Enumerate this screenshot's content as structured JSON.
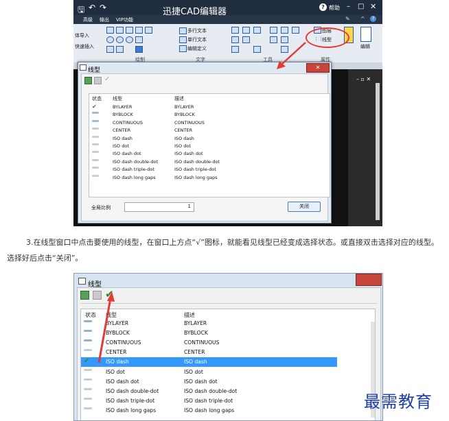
{
  "screenshot1": {
    "window_title": "迅捷CAD编辑器",
    "help_label": "帮助",
    "menu": [
      "高级",
      "输出",
      "VIP功能"
    ],
    "ribbon": {
      "left_labels": [
        "体导入",
        "快速插入"
      ],
      "text_labels": [
        "多行文本",
        "单行文本",
        "编辑定义"
      ],
      "groups": [
        "绘制",
        "文字",
        "工具",
        "属性"
      ],
      "linetype_button": "线型",
      "layer_button": "图层",
      "edit_label": "编辑"
    },
    "dialog": {
      "title": "线型",
      "columns": [
        "状态",
        "线型",
        "描述"
      ],
      "rows": [
        {
          "status": "current",
          "name": "BYLAYER",
          "desc": "BYLAYER"
        },
        {
          "status": "normal",
          "name": "BYBLOCK",
          "desc": "BYBLOCK"
        },
        {
          "status": "normal",
          "name": "CONTINUOUS",
          "desc": "CONTINUOUS"
        },
        {
          "status": "light",
          "name": "CENTER",
          "desc": "CENTER"
        },
        {
          "status": "light",
          "name": "ISO dash",
          "desc": "ISO dash"
        },
        {
          "status": "light",
          "name": "ISO dot",
          "desc": "ISO dot"
        },
        {
          "status": "light",
          "name": "ISO dash dot",
          "desc": "ISO dash dot"
        },
        {
          "status": "light",
          "name": "ISO dash double-dot",
          "desc": "ISO dash double-dot"
        },
        {
          "status": "light",
          "name": "ISO dash triple-dot",
          "desc": "ISO dash triple-dot"
        },
        {
          "status": "light",
          "name": "ISO dash long gaps",
          "desc": "ISO dash long gaps"
        }
      ],
      "scale_label": "全局比例",
      "scale_value": "1",
      "close_button": "关闭"
    }
  },
  "instruction": "3.在线型窗口中点击要使用的线型，在窗口上方点“√”图标，就能看见线型已经变成选择状态。或直接双击选择对应的线型。选择好后点击“关闭”。",
  "screenshot2": {
    "dialog_title": "线型",
    "columns": [
      "状态",
      "线型",
      "描述"
    ],
    "rows": [
      {
        "status": "normal",
        "name": "BYLAYER",
        "desc": "BYLAYER"
      },
      {
        "status": "normal",
        "name": "BYBLOCK",
        "desc": "BYBLOCK"
      },
      {
        "status": "normal",
        "name": "CONTINUOUS",
        "desc": "CONTINUOUS"
      },
      {
        "status": "light",
        "name": "CENTER",
        "desc": "CENTER"
      },
      {
        "status": "selected",
        "name": "ISO dash",
        "desc": "ISO dash"
      },
      {
        "status": "light",
        "name": "ISO dot",
        "desc": "ISO dot"
      },
      {
        "status": "light",
        "name": "ISO dash dot",
        "desc": "ISO dash dot"
      },
      {
        "status": "light",
        "name": "ISO dash double-dot",
        "desc": "ISO dash double-dot"
      },
      {
        "status": "light",
        "name": "ISO dash triple-dot",
        "desc": "ISO dash triple-dot"
      },
      {
        "status": "light",
        "name": "ISO dash long gaps",
        "desc": "ISO dash long gaps"
      }
    ]
  },
  "watermark": "最需教育",
  "colors": {
    "selection": "#3399ff",
    "annotation_red": "#e53935",
    "check_green": "#2e8b2e",
    "watermark_blue": "#1f3ea8"
  }
}
